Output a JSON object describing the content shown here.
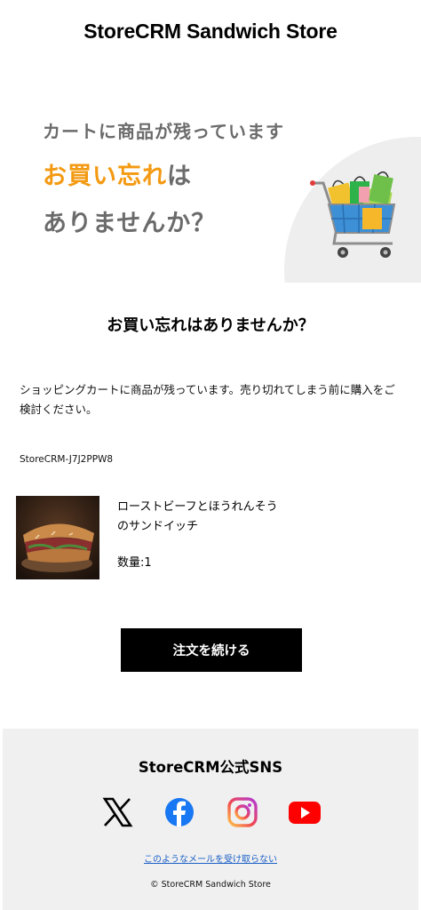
{
  "header": {
    "store_name": "StoreCRM Sandwich Store"
  },
  "hero": {
    "line1": "カートに商品が残っています",
    "line2_accent": "お買い忘れ",
    "line2_rest": "は",
    "line3": "ありませんか？",
    "illustration": "shopping-cart-icon",
    "colors": {
      "accent": "#f39a12",
      "text": "#6b6b6b",
      "circle": "#eeeeee"
    }
  },
  "main": {
    "headline": "お買い忘れはありませんか？",
    "message": "ショッピングカートに商品が残っています。売り切れてしまう前に購入をご検討ください。",
    "order_code": "StoreCRM-J7J2PPW8"
  },
  "cart_items": [
    {
      "name_line1": "ローストビーフとほうれんそう",
      "name_line2": "のサンドイッチ",
      "quantity": "数量:1"
    }
  ],
  "cta": {
    "label": "注文を続ける",
    "color": "#000000"
  },
  "footer": {
    "sns_title": "StoreCRM公式SNS",
    "sns_icons": [
      "x-icon",
      "facebook-icon",
      "instagram-icon",
      "youtube-icon"
    ],
    "unsubscribe": "このようなメールを受け取らない",
    "copyright": "© StoreCRM Sandwich Store",
    "colors": {
      "background": "#f0f0f0",
      "link": "#1a5fc7",
      "facebook": "#1877f2",
      "youtube": "#ff0000"
    }
  }
}
